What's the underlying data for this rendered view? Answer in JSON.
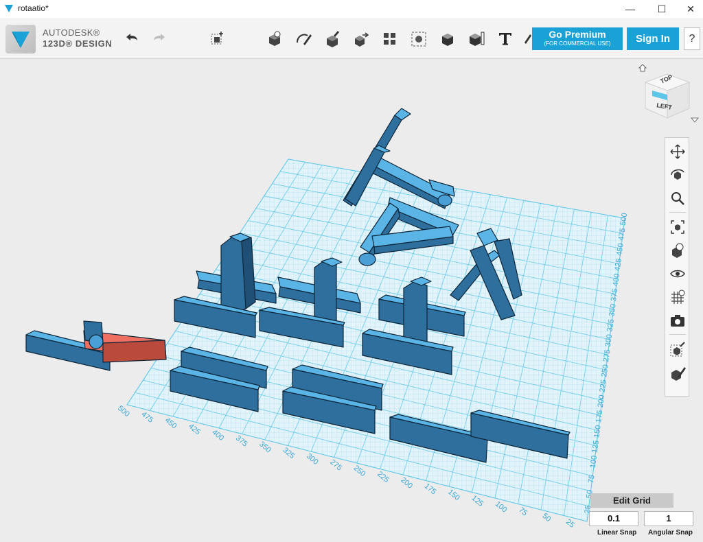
{
  "window": {
    "title": "rotaatio*",
    "minimize_glyph": "—",
    "maximize_glyph": "☐",
    "close_glyph": "✕"
  },
  "brand": {
    "line1": "AUTODESK®",
    "line2": "123D® DESIGN",
    "accent_color": "#1aa1d5"
  },
  "toolbar": {
    "premium_label": "Go Premium",
    "premium_sublabel": "(FOR COMMERCIAL USE)",
    "signin_label": "Sign In",
    "help_label": "?",
    "tools": [
      "undo-icon",
      "redo-icon",
      "transform-icon",
      "primitives-icon",
      "sketch-icon",
      "construct-icon",
      "modify-icon",
      "pattern-icon",
      "group-icon",
      "combine-icon",
      "measure-icon",
      "text-icon",
      "snap-icon"
    ]
  },
  "viewcube": {
    "top_label": "TOP",
    "left_label": "LEFT"
  },
  "grid": {
    "left_axis_ticks": [
      "500",
      "475",
      "450",
      "425",
      "400",
      "375",
      "350",
      "325",
      "300",
      "275",
      "250",
      "225",
      "200",
      "175",
      "150",
      "125",
      "100",
      "75",
      "50",
      "25"
    ],
    "right_axis_ticks": [
      "25",
      "50",
      "75",
      "100",
      "125",
      "150",
      "175",
      "200",
      "225",
      "250",
      "275",
      "300",
      "325",
      "350",
      "375",
      "400",
      "425",
      "450",
      "475",
      "500"
    ],
    "grid_color": "#5cc6e8",
    "part_color": "#5ab4e6",
    "selected_part_color": "#ef7060"
  },
  "nav_panel": [
    "pan-icon",
    "orbit-icon",
    "zoom-icon",
    "fit-icon",
    "view-perspective-icon",
    "visibility-icon",
    "grid-toggle-icon",
    "camera-icon",
    "material-icon",
    "outline-icon"
  ],
  "edit_grid": {
    "title": "Edit Grid",
    "linear_snap_value": "0.1",
    "linear_snap_label": "Linear Snap",
    "angular_snap_value": "1",
    "angular_snap_label": "Angular Snap"
  }
}
